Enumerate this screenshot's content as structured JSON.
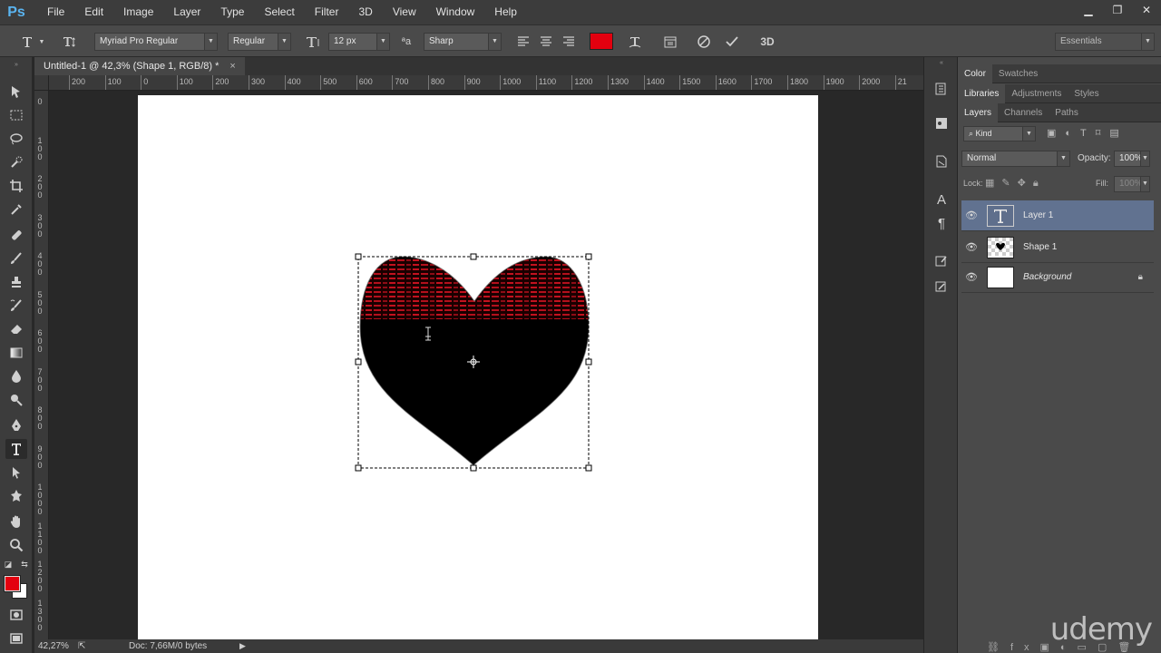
{
  "app": {
    "logo": "Ps"
  },
  "menu": [
    "File",
    "Edit",
    "Image",
    "Layer",
    "Type",
    "Select",
    "Filter",
    "3D",
    "View",
    "Window",
    "Help"
  ],
  "window_controls": {
    "minimize": "▁",
    "restore": "❐",
    "close": "✕"
  },
  "options": {
    "font_family": "Myriad Pro Regular",
    "font_style": "Regular",
    "font_size": "12 px",
    "antialias_icon_text": "ªa",
    "antialias": "Sharp",
    "text_color": "#e3000f",
    "workspace": "Essentials"
  },
  "document": {
    "tab_title": "Untitled-1 @ 42,3% (Shape 1, RGB/8) *",
    "close": "×"
  },
  "ruler_top": [
    "200",
    "100",
    "0",
    "100",
    "200",
    "300",
    "400",
    "500",
    "600",
    "700",
    "800",
    "900",
    "1000",
    "1100",
    "1200",
    "1300",
    "1400",
    "1500",
    "1600",
    "1700",
    "1800",
    "1900",
    "2000",
    "21"
  ],
  "ruler_left": [
    "0",
    "1\n0\n0",
    "2\n0\n0",
    "3\n0\n0",
    "4\n0\n0",
    "5\n0\n0",
    "6\n0\n0",
    "7\n0\n0",
    "8\n0\n0",
    "9\n0\n0",
    "1\n0\n0\n0",
    "1\n1\n0\n0",
    "1\n2\n0\n0",
    "1\n3\n0\n0"
  ],
  "status": {
    "zoom": "42,27%",
    "doc": "Doc: 7,66M/0 bytes"
  },
  "panels": {
    "top_tabs": [
      "Color",
      "Swatches"
    ],
    "mid_tabs": [
      "Libraries",
      "Adjustments",
      "Styles"
    ],
    "layer_tabs": [
      "Layers",
      "Channels",
      "Paths"
    ],
    "filter_kind": "Kind",
    "blend_mode": "Normal",
    "opacity_label": "Opacity:",
    "opacity_value": "100%",
    "lock_label": "Lock:",
    "fill_label": "Fill:",
    "fill_value": "100%",
    "layers": [
      {
        "name": "Layer 1",
        "type": "text",
        "selected": true
      },
      {
        "name": "Shape 1",
        "type": "shape",
        "selected": false
      },
      {
        "name": "Background",
        "type": "background",
        "selected": false
      }
    ]
  },
  "colors": {
    "foreground": "#e3000f",
    "background": "#ffffff"
  },
  "watermark": "udemy"
}
